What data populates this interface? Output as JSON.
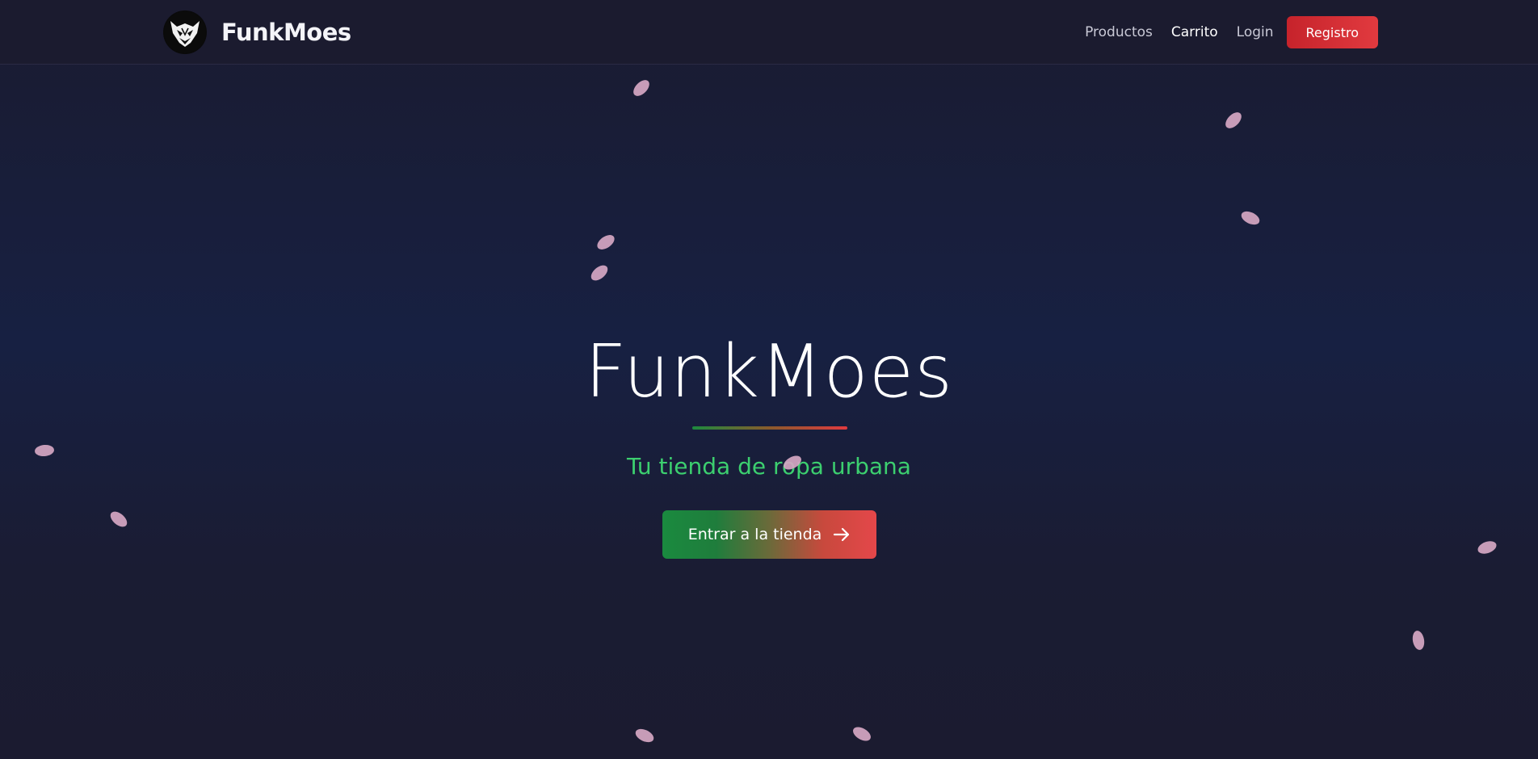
{
  "brand": {
    "name": "FunkMoes"
  },
  "nav": {
    "links": [
      {
        "label": "Productos"
      },
      {
        "label": "Carrito"
      },
      {
        "label": "Login"
      }
    ],
    "register_label": "Registro"
  },
  "hero": {
    "title": "FunkMoes",
    "subtitle": "Tu tienda de ropa urbana",
    "cta_label": "Entrar a la tienda"
  },
  "colors": {
    "background": "#1a1b30",
    "navbar": "#1b1b2f",
    "accent_green": "#3ccf6f",
    "accent_red": "#e13a3f",
    "petal": "#d6a7c3"
  },
  "icons": {
    "logo": "wolf-logo-icon",
    "cta": "arrow-right-icon",
    "decoration": "petal-icon"
  }
}
